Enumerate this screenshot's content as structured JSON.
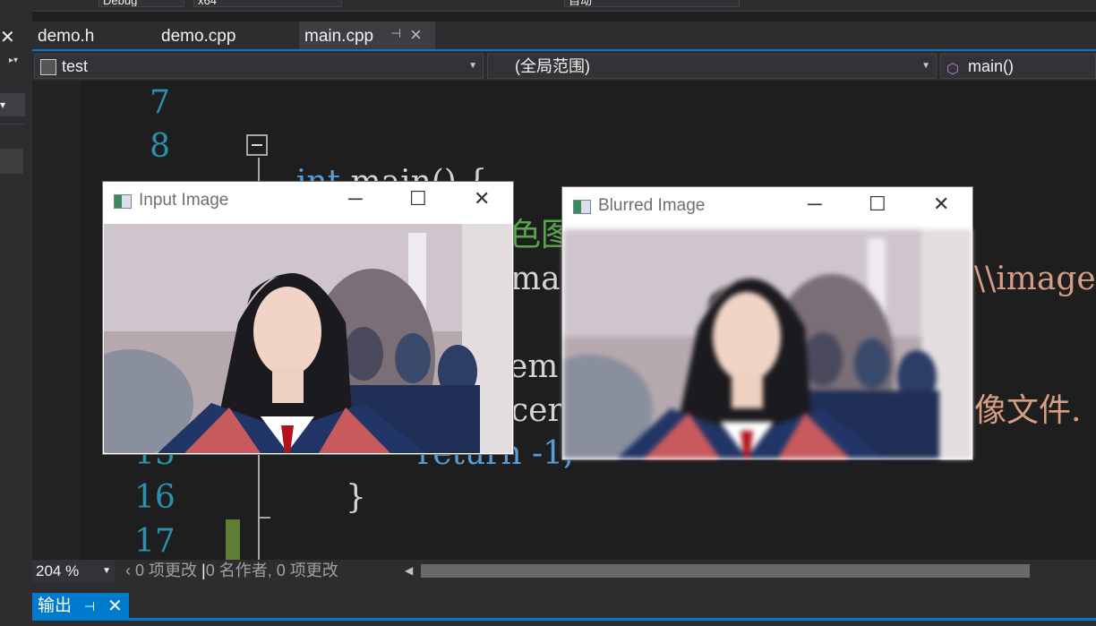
{
  "toolbar": {
    "config": "Debug",
    "platform": "x64",
    "combo_right": "自动"
  },
  "tabs": [
    {
      "label": "demo.h"
    },
    {
      "label": "demo.cpp"
    },
    {
      "label": "main.cpp",
      "active": true
    }
  ],
  "nav": {
    "project": "test",
    "scope": "(全局范围)",
    "member": "main()"
  },
  "code_lines": [
    {
      "num": "7",
      "text": ""
    },
    {
      "num": "8",
      "text": "int main() {"
    },
    {
      "num": "15",
      "text": "return -1;"
    },
    {
      "num": "16",
      "text": "}"
    },
    {
      "num": "17",
      "text": ""
    }
  ],
  "visible_fragments": {
    "comment_fragment": "色图",
    "image_fragment": "mag",
    "path_fragment": "\\\\image",
    "empty_fragment": "em",
    "cerr_fragment": "cer",
    "chinese_fragment": "像文件."
  },
  "status": {
    "zoom": "204 %",
    "changes": "0 项更改",
    "authors": "0 名作者, 0 项更改"
  },
  "output_panel": {
    "title": "输出"
  },
  "windows": [
    {
      "title": "Input Image"
    },
    {
      "title": "Blurred Image"
    }
  ],
  "colors": {
    "accent": "#007acc",
    "line_number": "#2b91af",
    "keyword": "#569cd6",
    "string": "#d69d85",
    "comment": "#57a64a"
  }
}
